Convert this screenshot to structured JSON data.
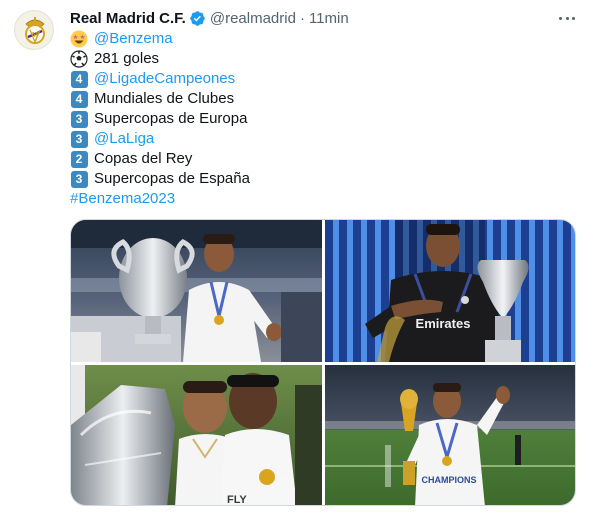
{
  "tweet": {
    "display_name": "Real Madrid C.F.",
    "handle": "@realmadrid",
    "separator": "·",
    "timestamp": "11min",
    "avatar_icon": "real-madrid-crest-icon",
    "verified_icon": "verified-badge-icon",
    "more_icon": "more-options-icon",
    "accent_color": "#1d9bf0"
  },
  "lines": [
    {
      "icon": "star-struck-emoji",
      "prefix": "",
      "text": "@Benzema",
      "is_link": true
    },
    {
      "icon": "soccer-ball-emoji",
      "prefix": "",
      "text": "281 goles",
      "is_link": false
    },
    {
      "icon": "keycap",
      "prefix": "4",
      "text": "@LigadeCampeones",
      "is_link": true
    },
    {
      "icon": "keycap",
      "prefix": "4",
      "text": "Mundiales de Clubes",
      "is_link": false
    },
    {
      "icon": "keycap",
      "prefix": "3",
      "text": "Supercopas de Europa",
      "is_link": false
    },
    {
      "icon": "keycap",
      "prefix": "3",
      "text": "@LaLiga",
      "is_link": true
    },
    {
      "icon": "keycap",
      "prefix": "2",
      "text": "Copas del Rey",
      "is_link": false
    },
    {
      "icon": "keycap",
      "prefix": "3",
      "text": "Supercopas de España",
      "is_link": false
    },
    {
      "icon": "",
      "prefix": "",
      "text": "#Benzema2023",
      "is_link": true
    }
  ],
  "media": {
    "photos": [
      {
        "name": "photo-champions-trophy",
        "jersey_text": ""
      },
      {
        "name": "photo-super-cup-trophy",
        "jersey_text": "Emirates"
      },
      {
        "name": "photo-league-trophy",
        "jersey_text": "FLY"
      },
      {
        "name": "photo-club-world-cup",
        "jersey_text": "CHAMPIONS"
      }
    ]
  }
}
